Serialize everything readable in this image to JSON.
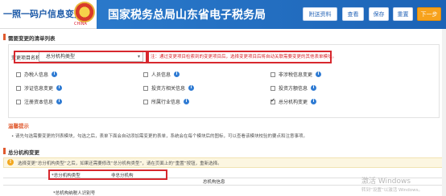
{
  "header": {
    "app_title": "一照一码户信息变更",
    "emblem_caption": "CHINA",
    "bureau_title": "国家税务总局山东省电子税务局",
    "buttons": [
      "附送资料",
      "查看",
      "保存",
      "重置",
      "下一步"
    ],
    "accent": "#f7a21c",
    "brand": "#1c63b6"
  },
  "section": {
    "title": "需要变更的清单列表"
  },
  "filter": {
    "label": "变更项目名称",
    "value": "总分机构类型",
    "note": "注：通过变更项目检索到的变更项目后，选择变更项目后将自动关联需要变更的其他表单模块。"
  },
  "checkboxes": [
    {
      "label": "办税人信息",
      "checked": false
    },
    {
      "label": "人员信息",
      "checked": false
    },
    {
      "label": "非涉税信息变更",
      "checked": false
    },
    {
      "label": "涉证信息变更",
      "checked": false
    },
    {
      "label": "投资方相关信息",
      "checked": false
    },
    {
      "label": "投资方额信息",
      "checked": false
    },
    {
      "label": "注册资本信息",
      "checked": false
    },
    {
      "label": "所属行业信息",
      "checked": false
    },
    {
      "label": "总分机构变更",
      "checked": true
    }
  ],
  "hint": {
    "title": "温馨提示",
    "text": "• 请先勾选需要变更的列表模块，勾选之后，表单下面会自动添加需变更的表单，系统会在每个模块后的图标，可以查看该模块校验的要点和注意事项。"
  },
  "group": {
    "title": "总分机构变更",
    "warning": "选择变更“总分机构类型”之后，如果还需要修改“总分机构类型”，请在页面上的“重置”按钮，重新选择。",
    "row_label": "*总分机构类型",
    "row_value": "非总分机构",
    "table_header": "总机构信息",
    "row2_label": "*总机构纳税人识别号"
  },
  "watermark": {
    "line1": "激活 Windows",
    "line2": "转到“设置”以激活 Windows。"
  }
}
